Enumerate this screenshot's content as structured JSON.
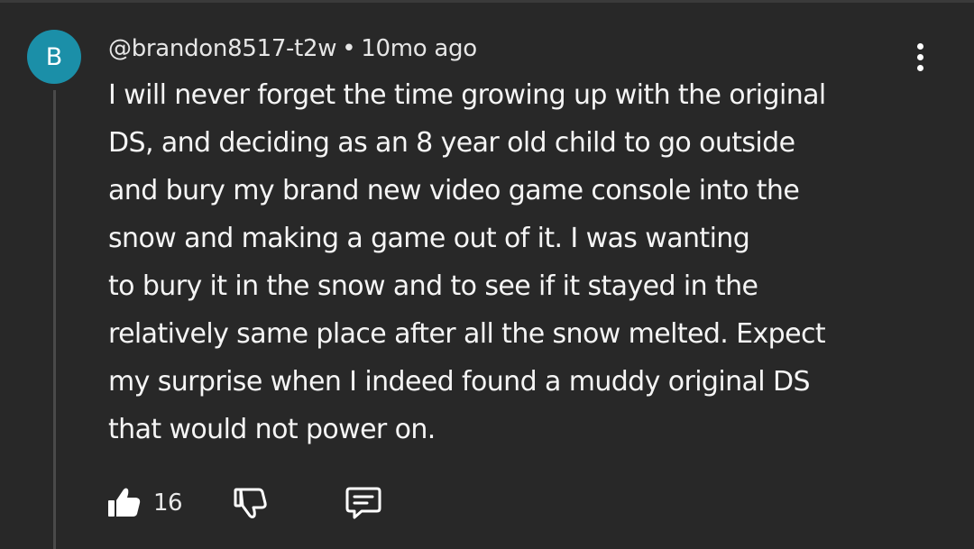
{
  "comment": {
    "avatar_letter": "B",
    "avatar_color": "#1b8fa8",
    "author": "@brandon8517-t2w",
    "separator": "•",
    "time_ago": "10mo ago",
    "lines": [
      "I will never forget the time growing up with the original",
      "DS, and deciding as an 8 year old child to go outside",
      "and bury my brand new video game console into the",
      "snow and making a game out of it. I was wanting",
      "to bury it in the snow and to see if it stayed in the",
      "relatively same place after all the snow melted. Expect",
      "my surprise when I indeed found a muddy original DS",
      "that would not power on."
    ],
    "like_count": "16"
  },
  "icons": {
    "more": "more-vert-icon",
    "like": "thumbs-up-icon",
    "dislike": "thumbs-down-icon",
    "reply": "comment-reply-icon"
  },
  "colors": {
    "background": "#282828",
    "text": "#f5f5f5"
  }
}
